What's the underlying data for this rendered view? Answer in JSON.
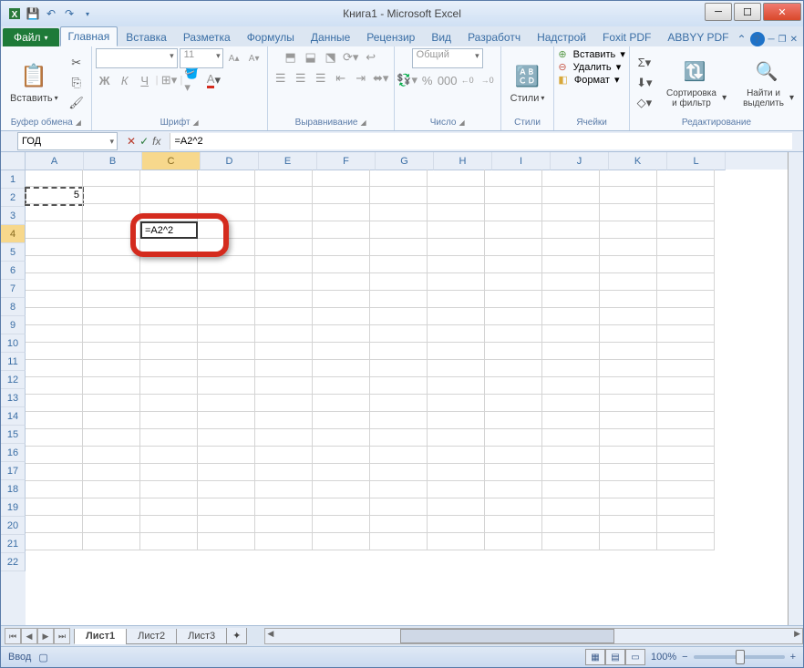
{
  "window": {
    "title": "Книга1 - Microsoft Excel"
  },
  "tabs": {
    "file": "Файл",
    "home": "Главная",
    "insert": "Вставка",
    "layout": "Разметка",
    "formulas": "Формулы",
    "data": "Данные",
    "review": "Рецензир",
    "view": "Вид",
    "developer": "Разработч",
    "addins": "Надстрой",
    "foxit": "Foxit PDF",
    "abbyy": "ABBYY PDF"
  },
  "ribbon": {
    "paste": "Вставить",
    "clipboard": "Буфер обмена",
    "font_size": "11",
    "font_group": "Шрифт",
    "alignment": "Выравнивание",
    "number_fmt": "Общий",
    "number": "Число",
    "styles_btn": "Стили",
    "styles": "Стили",
    "insert_btn": "Вставить",
    "delete_btn": "Удалить",
    "format_btn": "Формат",
    "cells": "Ячейки",
    "sort": "Сортировка и фильтр",
    "find": "Найти и выделить",
    "editing": "Редактирование"
  },
  "formula_bar": {
    "name_box": "ГОД",
    "formula": "=A2^2"
  },
  "grid": {
    "columns": [
      "A",
      "B",
      "C",
      "D",
      "E",
      "F",
      "G",
      "H",
      "I",
      "J",
      "K",
      "L"
    ],
    "rows": 22,
    "a2_value": "5",
    "c4_value": "=A2^2",
    "selected_col": "C",
    "selected_row": 4,
    "marquee_cell": "A2"
  },
  "sheets": {
    "s1": "Лист1",
    "s2": "Лист2",
    "s3": "Лист3"
  },
  "status": {
    "mode": "Ввод",
    "zoom": "100%"
  }
}
